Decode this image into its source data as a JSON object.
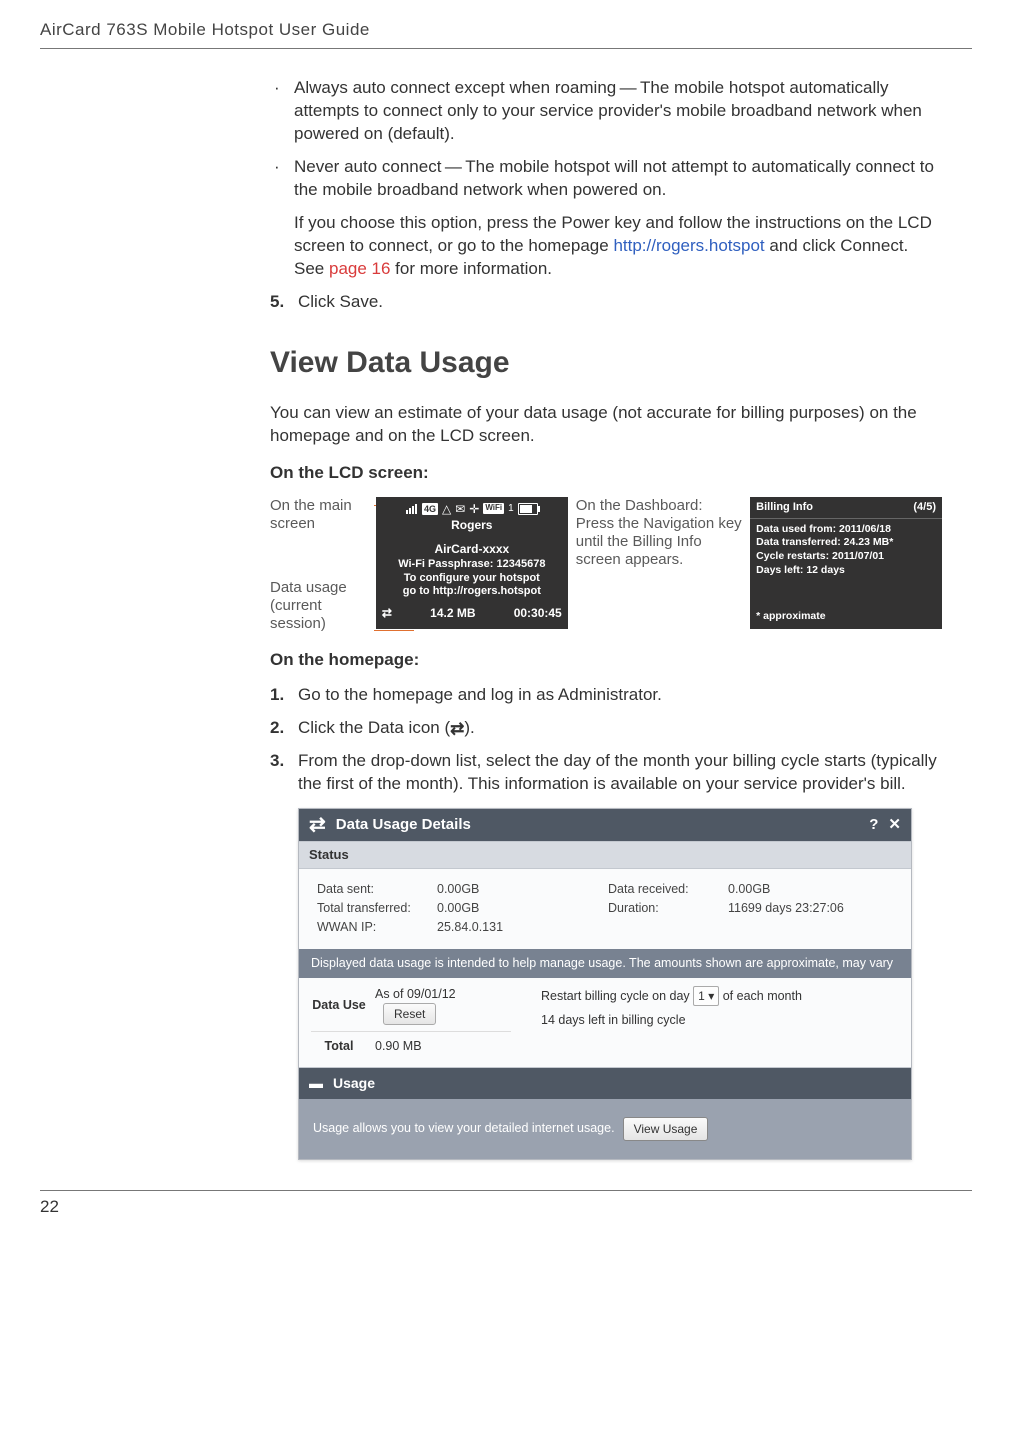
{
  "header": "AirCard 763S Mobile Hotspot User Guide",
  "bullets": {
    "b1": "Always auto connect except when roaming — The mobile hotspot automatically attempts to connect only to your service provider's mobile broadband network when powered on (default).",
    "b2": "Never auto connect — The mobile hotspot will not attempt to automatically connect to the mobile broadband network when powered on.",
    "b2_sub_1": "If you choose this option, press the Power key and follow the instructions on the LCD screen to connect, or go to the homepage ",
    "b2_link": "http://rogers.hotspot",
    "b2_sub_2": " and click Connect. See ",
    "b2_pref": "page 16",
    "b2_sub_3": " for more information."
  },
  "step5_num": "5.",
  "step5_text": "Click Save.",
  "section_title": "View Data Usage",
  "intro": "You can view an estimate of your data usage (not accurate for billing purposes) on the homepage and on the LCD screen.",
  "on_lcd": "On the LCD screen:",
  "lcd": {
    "left_top": "On the main screen",
    "left_bot": "Data usage (current session)",
    "carrier": "Rogers",
    "ssid": "AirCard-xxxx",
    "pass": "Wi-Fi Passphrase: 12345678",
    "conf1": "To configure your hotspot",
    "conf2": "go to http://rogers.hotspot",
    "mb": "14.2 MB",
    "time": "00:30:45",
    "mid_text": "On the Dashboard: Press the Navigation key until the Billing Info screen appears.",
    "b_title": "Billing Info",
    "b_page": "(4/5)",
    "line1": "Data used from: 2011/06/18",
    "line2": "Data transferred: 24.23 MB*",
    "line3": "Cycle restarts: 2011/07/01",
    "line4": "Days left: 12 days",
    "foot": "* approximate",
    "fourg": "4G",
    "wifi_label": "WiFi",
    "wifi_count": "1"
  },
  "on_home": "On the homepage:",
  "steps": {
    "s1n": "1.",
    "s1": "Go to the homepage and log in as Administrator.",
    "s2n": "2.",
    "s2a": "Click the Data icon (",
    "s2b": ").",
    "s3n": "3.",
    "s3": "From the drop-down list, select the day of the month your billing cycle starts (typically the first of the month). This information is available on your service provider's bill."
  },
  "panel": {
    "title": "Data Usage Details",
    "status": "Status",
    "sent_k": "Data sent:",
    "sent_v": "0.00GB",
    "tot_k": "Total transferred:",
    "tot_v": "0.00GB",
    "ip_k": "WWAN IP:",
    "ip_v": "25.84.0.131",
    "recv_k": "Data received:",
    "recv_v": "0.00GB",
    "dur_k": "Duration:",
    "dur_v": "11699 days 23:27:06",
    "note": "Displayed data usage is intended to help manage usage. The amounts shown are approximate, may vary",
    "du": "Data Use",
    "asof": "As of 09/01/12",
    "reset": "Reset",
    "restart_a": "Restart billing cycle on day",
    "restart_day": "1",
    "restart_b": "of each month",
    "daysleft": "14 days left in billing cycle",
    "total_k": "Total",
    "total_v": "0.90 MB",
    "usage_h": "Usage",
    "usage_txt": "Usage allows you to view your detailed internet usage.",
    "view_usage": "View Usage",
    "help": "?",
    "close": "✕"
  },
  "page_num": "22"
}
